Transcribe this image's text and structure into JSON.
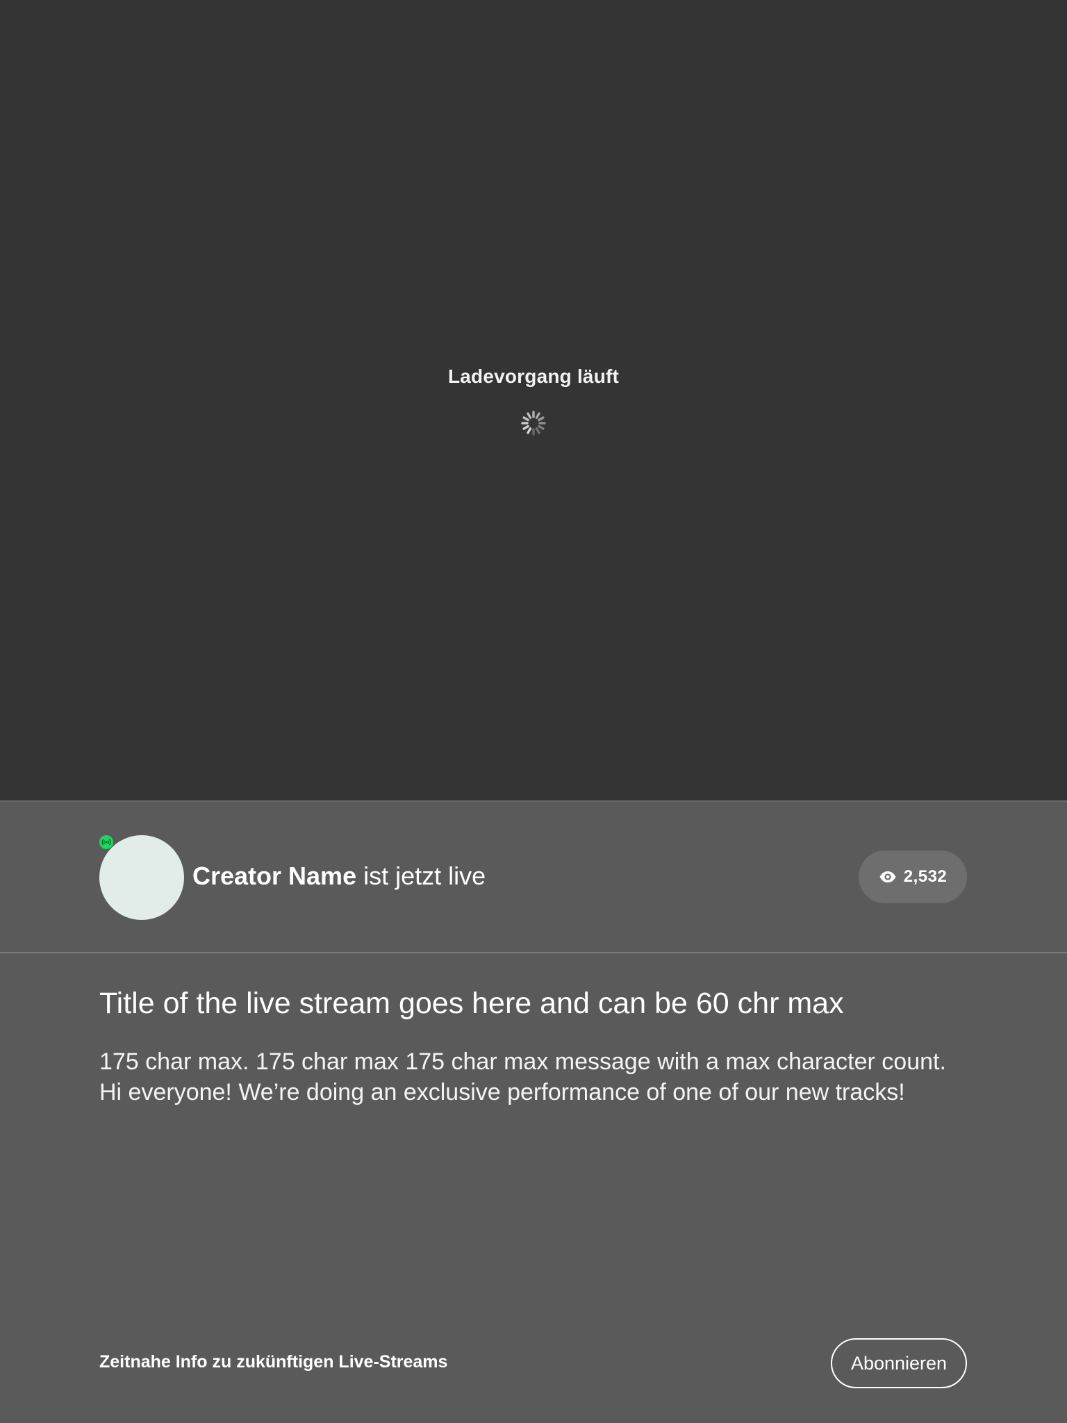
{
  "player": {
    "loading_text": "Ladevorgang läuft",
    "spinner_icon": "loading-spinner-icon",
    "background_color": "#343434"
  },
  "creator": {
    "name": "Creator Name",
    "status_text": " ist jetzt live",
    "live_indicator_icon": "broadcast-icon",
    "live_indicator_color": "#1ed760"
  },
  "viewers": {
    "icon": "eye-icon",
    "count": "2,532"
  },
  "stream": {
    "title": "Title of the live stream goes here and can be 60 chr max",
    "description": "175 char max. 175 char max 175 char max message with a max character count. Hi everyone! We’re doing an exclusive performance of one of our new tracks!"
  },
  "footer": {
    "info_text": "Zeitnahe Info zu zukünftigen Live-Streams",
    "subscribe_label": "Abonnieren"
  }
}
